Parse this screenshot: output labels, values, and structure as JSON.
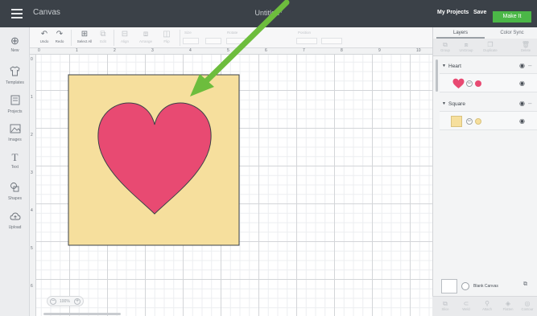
{
  "header": {
    "app_name": "Canvas",
    "document_title": "Untitled*",
    "my_projects": "My Projects",
    "save": "Save",
    "make_it": "Make It"
  },
  "left_tools": [
    {
      "label": "New",
      "icon": "plus-circle-icon",
      "glyph": "⊕"
    },
    {
      "label": "Templates",
      "icon": "shirt-icon",
      "glyph": "👕"
    },
    {
      "label": "Projects",
      "icon": "projects-icon",
      "glyph": "▤"
    },
    {
      "label": "Images",
      "icon": "image-icon",
      "glyph": "▨"
    },
    {
      "label": "Text",
      "icon": "text-icon",
      "glyph": "T"
    },
    {
      "label": "Shapes",
      "icon": "shapes-icon",
      "glyph": "◍"
    },
    {
      "label": "Upload",
      "icon": "cloud-upload-icon",
      "glyph": "☁"
    }
  ],
  "toolbar": {
    "undo": "Undo",
    "redo": "Redo",
    "select_all": "Select All",
    "edit": "Edit",
    "align": "Align",
    "arrange": "Arrange",
    "flip": "Flip",
    "size": "Size",
    "rotate": "Rotate",
    "position": "Position"
  },
  "rulers": {
    "top": [
      "0",
      "1",
      "2",
      "3",
      "4",
      "5",
      "6",
      "7",
      "8",
      "9",
      "10"
    ],
    "left": [
      "0",
      "1",
      "2",
      "3",
      "4",
      "5",
      "6"
    ]
  },
  "canvas": {
    "square_color": "#f6df9d",
    "heart_color": "#e84a72",
    "arrow_color": "#6dbd3d"
  },
  "zoom": {
    "value": "100%"
  },
  "panel": {
    "tabs": [
      "Layers",
      "Color Sync"
    ],
    "tools": [
      "Group",
      "UnGroup",
      "Duplicate",
      "Delete"
    ],
    "layers": [
      {
        "name": "Heart",
        "color": "#e84a72",
        "icon": "heart-icon"
      },
      {
        "name": "Square",
        "color": "#f6df9d",
        "icon": "square-icon"
      }
    ],
    "blank_canvas": "Blank Canvas",
    "bottom_tools": [
      "Slice",
      "Weld",
      "Attach",
      "Flatten",
      "Contour"
    ]
  }
}
